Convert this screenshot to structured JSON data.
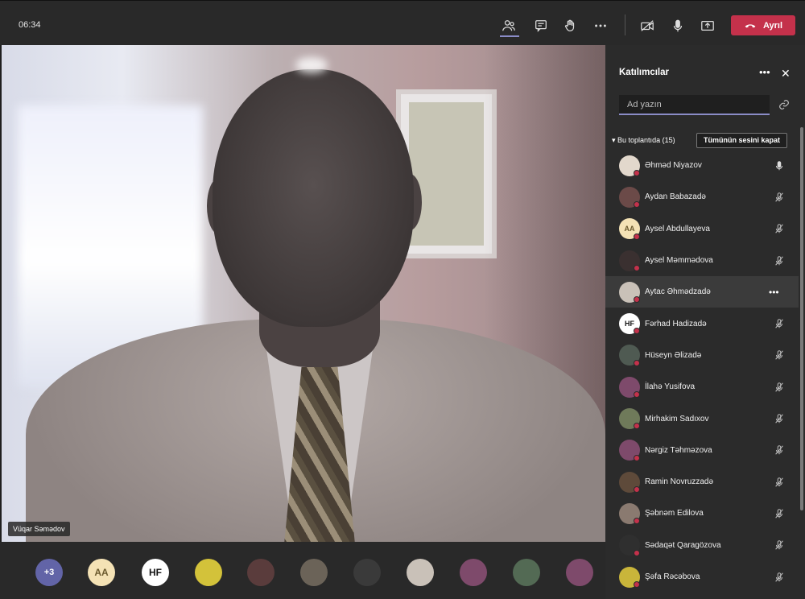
{
  "topbar": {
    "timer": "06:34",
    "leave_label": "Ayrıl",
    "leave_color": "#c4314b",
    "icons": [
      "participants-icon",
      "chat-icon",
      "raise-hand-icon",
      "more-icon",
      "camera-off-icon",
      "mic-icon",
      "share-screen-icon",
      "phone-hangup-icon"
    ]
  },
  "video": {
    "speaker_name": "Vüqar Səmədov"
  },
  "bottom_strip": {
    "overflow_label": "+3",
    "avatars": [
      {
        "initials": "AA",
        "bg": "#f4e2b5",
        "fg": "#6b5a2e"
      },
      {
        "initials": "HF",
        "bg": "#ffffff",
        "fg": "#111111"
      },
      {
        "initials": "",
        "bg": "#d3c23a",
        "fg": "#fff"
      },
      {
        "initials": "",
        "bg": "#5a3c3c",
        "fg": "#fff"
      },
      {
        "initials": "",
        "bg": "#6b6358",
        "fg": "#fff"
      },
      {
        "initials": "",
        "bg": "#3a3a3a",
        "fg": "#fff"
      },
      {
        "initials": "",
        "bg": "#c9c1b8",
        "fg": "#fff"
      },
      {
        "initials": "",
        "bg": "#7e4a6b",
        "fg": "#fff"
      },
      {
        "initials": "",
        "bg": "#536a54",
        "fg": "#fff"
      },
      {
        "initials": "",
        "bg": "#7e4a6b",
        "fg": "#fff"
      }
    ]
  },
  "panel": {
    "title": "Katılımcılar",
    "search_placeholder": "Ad yazın",
    "section_label": "Bu toplantıda (15)",
    "mute_all_label": "Tümünün sesini kapat",
    "participants": [
      {
        "name": "Əhməd Niyazov",
        "initials": "",
        "bg": "#e2d8cc",
        "fg": "#333",
        "mic": "on"
      },
      {
        "name": "Aydan Babazadə",
        "initials": "",
        "bg": "#6b4a48",
        "fg": "#fff",
        "mic": "off"
      },
      {
        "name": "Aysel Abdullayeva",
        "initials": "AA",
        "bg": "#f4e2b5",
        "fg": "#6b5a2e",
        "mic": "off"
      },
      {
        "name": "Aysel Məmmədova",
        "initials": "",
        "bg": "#3a3030",
        "fg": "#fff",
        "mic": "off"
      },
      {
        "name": "Aytac Əhmədzadə",
        "initials": "",
        "bg": "#c9c1b8",
        "fg": "#fff",
        "mic": "more"
      },
      {
        "name": "Fərhad Hadizadə",
        "initials": "HF",
        "bg": "#ffffff",
        "fg": "#111",
        "mic": "off"
      },
      {
        "name": "Hüseyn Əlizadə",
        "initials": "",
        "bg": "#4f5a52",
        "fg": "#fff",
        "mic": "off"
      },
      {
        "name": "İlahə Yusifova",
        "initials": "",
        "bg": "#7e4a6b",
        "fg": "#fff",
        "mic": "off"
      },
      {
        "name": "Mirhakim Sadıxov",
        "initials": "",
        "bg": "#6f7a5a",
        "fg": "#fff",
        "mic": "off"
      },
      {
        "name": "Nərgiz Təhməzova",
        "initials": "",
        "bg": "#7e4a6b",
        "fg": "#fff",
        "mic": "off"
      },
      {
        "name": "Ramin Novruzzadə",
        "initials": "",
        "bg": "#5e4a3a",
        "fg": "#fff",
        "mic": "off"
      },
      {
        "name": "Şəbnəm Edilova",
        "initials": "",
        "bg": "#8a7a70",
        "fg": "#fff",
        "mic": "off"
      },
      {
        "name": "Sədaqət Qaragözova",
        "initials": "",
        "bg": "#2f2f2f",
        "fg": "#fff",
        "mic": "off"
      },
      {
        "name": "Şəfa Rəcəbova",
        "initials": "",
        "bg": "#c9b53a",
        "fg": "#fff",
        "mic": "off"
      }
    ]
  }
}
